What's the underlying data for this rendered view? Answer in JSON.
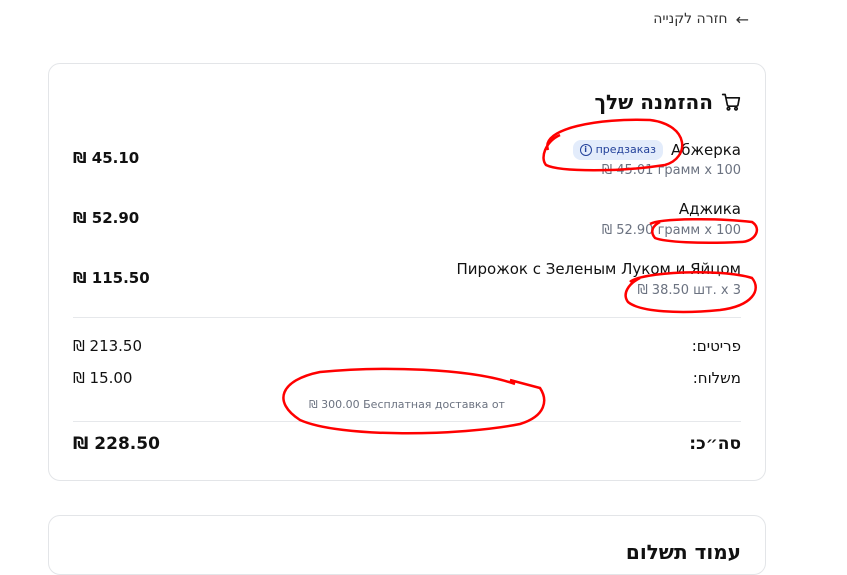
{
  "back_link": {
    "label": "חזרה לקנייה",
    "icon": "arrow-left-icon"
  },
  "order": {
    "title": "ההזמנה שלך",
    "items": [
      {
        "name": "Абжерка",
        "badge": "предзаказ",
        "qty": "₪ 45.01 грамм x 100",
        "total": "₪ 45.10"
      },
      {
        "name": "Аджика",
        "qty": "₪ 52.90 грамм x 100",
        "total": "₪ 52.90"
      },
      {
        "name": "Пирожок с Зеленым Луком и Яйцом",
        "qty": "₪ 38.50 шт. x 3",
        "total": "₪ 115.50"
      }
    ],
    "summary": {
      "items_label": "פריטים:",
      "items_value": "₪ 213.50",
      "shipping_label": "משלוח:",
      "shipping_value": "₪ 15.00",
      "free_shipping_note": "₪ 300.00 Бесплатная доставка от",
      "total_label": "סה״כ:",
      "total_value": "₪ 228.50"
    }
  },
  "payment_section": {
    "title": "עמוד תשלום"
  },
  "colors": {
    "annotation": "#ff0000",
    "badge_bg": "#e3ecfb",
    "badge_text": "#24429a"
  }
}
